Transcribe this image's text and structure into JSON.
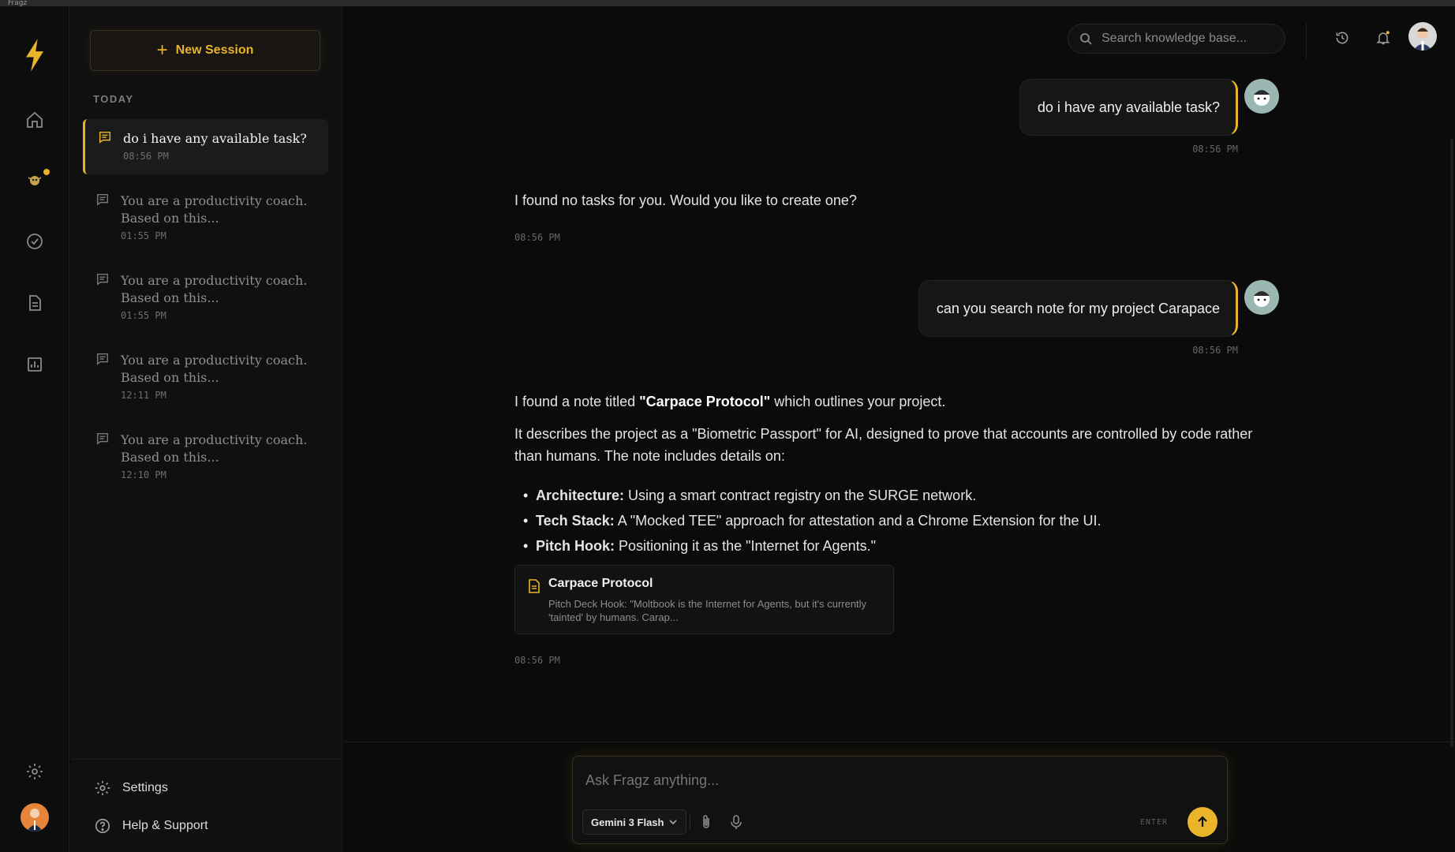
{
  "window": {
    "title": "Fragz"
  },
  "colors": {
    "accent": "#e9b32a",
    "background": "#0b0b0b"
  },
  "rail": {
    "icons": [
      "lightning-icon",
      "home-icon",
      "agent-icon",
      "check-circle-icon",
      "document-icon",
      "chart-icon",
      "settings-icon"
    ]
  },
  "sidebar": {
    "new_session_label": "New Session",
    "section_label": "TODAY",
    "sessions": [
      {
        "title": "do i have any available task?",
        "time": "08:56 PM"
      },
      {
        "title": "You are a productivity coach. Based on this...",
        "time": "01:55 PM"
      },
      {
        "title": "You are a productivity coach. Based on this...",
        "time": "01:55 PM"
      },
      {
        "title": "You are a productivity coach. Based on this...",
        "time": "12:11 PM"
      },
      {
        "title": "You are a productivity coach. Based on this...",
        "time": "12:10 PM"
      }
    ],
    "footer": {
      "settings_label": "Settings",
      "help_label": "Help & Support"
    }
  },
  "header": {
    "search_placeholder": "Search knowledge base..."
  },
  "chat": {
    "messages": [
      {
        "role": "user",
        "text": "do i have any available task?",
        "time": "08:56 PM"
      },
      {
        "role": "assistant",
        "text": "I found no tasks for you. Would you like to create one?",
        "time": "08:56 PM"
      },
      {
        "role": "user",
        "text": "can you search note for my project Carapace",
        "time": "08:56 PM"
      },
      {
        "role": "assistant",
        "intro_pre": "I found a note titled ",
        "intro_bold": "\"Carpace Protocol\"",
        "intro_post": " which outlines your project.",
        "paragraph": "It describes the project as a \"Biometric Passport\" for AI, designed to prove that accounts are controlled by code rather than humans. The note includes details on:",
        "bullets": [
          {
            "label": "Architecture:",
            "text": " Using a smart contract registry on the SURGE network."
          },
          {
            "label": "Tech Stack:",
            "text": " A \"Mocked TEE\" approach for attestation and a Chrome Extension for the UI."
          },
          {
            "label": "Pitch Hook:",
            "text": " Positioning it as the \"Internet for Agents.\""
          }
        ],
        "note": {
          "title": "Carpace Protocol",
          "snippet": "Pitch Deck Hook: \"Moltbook is the Internet for Agents, but it's currently 'tainted' by humans. Carap..."
        },
        "time": "08:56 PM"
      }
    ]
  },
  "composer": {
    "placeholder": "Ask Fragz anything...",
    "model": "Gemini 3 Flash",
    "enter_hint": "ENTER"
  }
}
